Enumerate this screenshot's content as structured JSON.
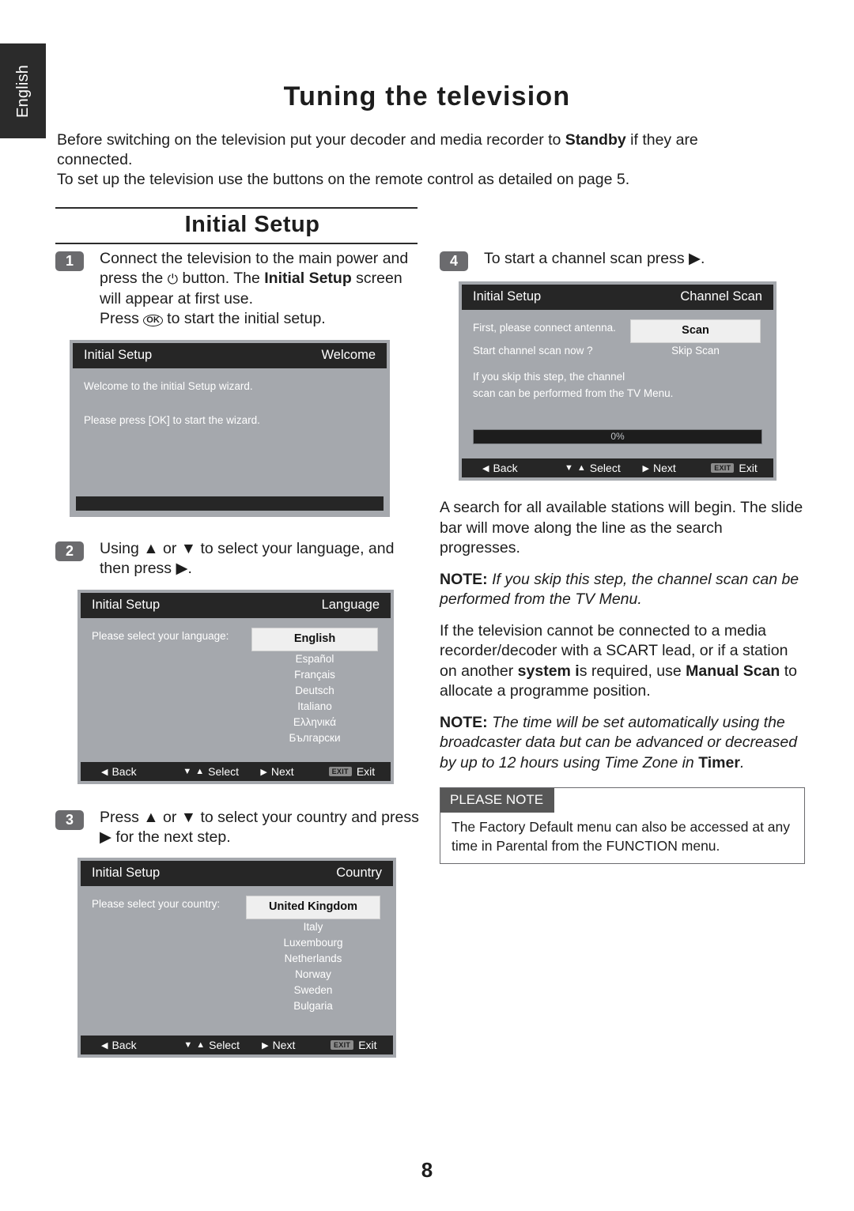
{
  "sidebar": {
    "language_tab": "English"
  },
  "header": {
    "title": "Tuning the television"
  },
  "intro": {
    "line1_a": "Before switching on the television put your decoder and media recorder to ",
    "line1_bold": "Standby",
    "line1_b": " if they are connected.",
    "line2": "To set up the television use the buttons on the remote control as detailed on page 5."
  },
  "banner": {
    "title": "Initial Setup"
  },
  "steps": {
    "one": {
      "num": "1",
      "t1": "Connect the television to the main power and press the ",
      "t2": " button. The ",
      "bold": "Initial Setup",
      "t3": " screen will appear at first use.",
      "t4": "Press ",
      "t5": " to start the initial setup."
    },
    "two": {
      "num": "2",
      "text": "Using ▲ or ▼ to select your language, and then press ▶."
    },
    "three": {
      "num": "3",
      "text": "Press ▲ or ▼ to select your country and press ▶ for the next step."
    },
    "four": {
      "num": "4",
      "text": "To start a channel scan press ▶."
    }
  },
  "osd_welcome": {
    "title": "Initial Setup",
    "screen": "Welcome",
    "line1": "Welcome to the initial Setup wizard.",
    "line2": "Please press [OK] to start the wizard."
  },
  "osd_language": {
    "title": "Initial Setup",
    "screen": "Language",
    "prompt": "Please select your language:",
    "selected": "English",
    "options": [
      "Español",
      "Français",
      "Deutsch",
      "Italiano",
      "Ελληνικά",
      "Български"
    ],
    "footer": {
      "back": "Back",
      "select": "Select",
      "next": "Next",
      "exit_key": "EXIT",
      "exit": "Exit"
    }
  },
  "osd_country": {
    "title": "Initial Setup",
    "screen": "Country",
    "prompt": "Please select your country:",
    "selected": "United Kingdom",
    "options": [
      "Italy",
      "Luxembourg",
      "Netherlands",
      "Norway",
      "Sweden",
      "Bulgaria"
    ],
    "footer": {
      "back": "Back",
      "select": "Select",
      "next": "Next",
      "exit_key": "EXIT",
      "exit": "Exit"
    }
  },
  "osd_channel_scan": {
    "title": "Initial Setup",
    "screen": "Channel Scan",
    "line1": "First, please connect antenna.",
    "line2": "Start channel scan now ?",
    "line3": "If you skip this step, the channel",
    "line4": "scan can be performed from the TV Menu.",
    "selected": "Scan",
    "options": [
      "Skip Scan"
    ],
    "progress": "0%",
    "footer": {
      "back": "Back",
      "select": "Select",
      "next": "Next",
      "exit_key": "EXIT",
      "exit": "Exit"
    }
  },
  "right_text": {
    "para1": "A search for all available stations will begin. The slide bar will move along the line as the search progresses.",
    "note1_label": "NOTE:",
    "note1": " If you skip this step, the channel scan can be performed from the TV Menu.",
    "para2_a": "If the television cannot be connected to a media recorder/decoder with a SCART lead, or if a station on another ",
    "para2_b1": "system i",
    "para2_c": "s required, use ",
    "para2_b2": "Manual Scan",
    "para2_d": " to allocate a programme position.",
    "note2_label": "NOTE:",
    "note2_a": " The time will be set automatically using the broadcaster data but can be advanced or decreased by up to 12 hours using Time Zone in ",
    "note2_b": "Timer",
    "note2_c": "."
  },
  "please_note": {
    "heading": "PLEASE NOTE",
    "body": "The Factory Default menu can also be accessed at any time in Parental from the FUNCTION menu."
  },
  "footer": {
    "page_number": "8"
  },
  "colors": {
    "tab_bg": "#2b2b2b",
    "osd_bar": "#262626",
    "osd_body": "#a5a8ad",
    "step_badge": "#6b6b6e",
    "note_head": "#575757"
  }
}
